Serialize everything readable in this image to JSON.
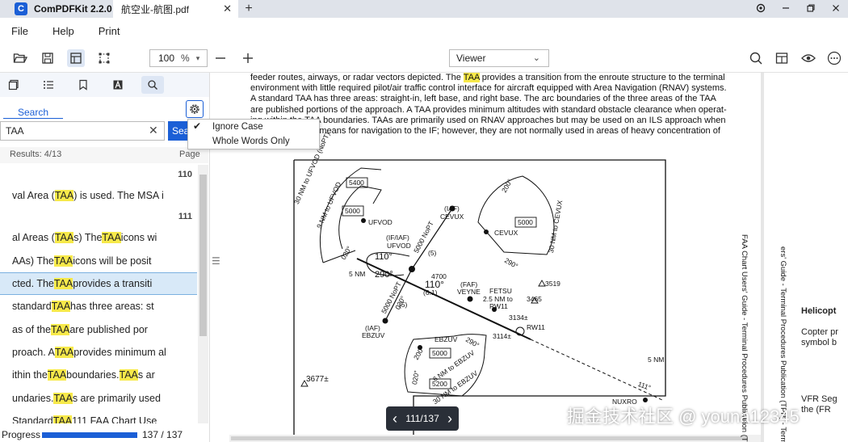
{
  "titlebar": {
    "app_name": "ComPDFKit 2.2.0",
    "app_logo": "C",
    "doc_tab": "航空业-航图.pdf",
    "close_glyph": "✕",
    "new_tab_glyph": "+"
  },
  "menu": [
    "File",
    "Help",
    "Print"
  ],
  "toolbar": {
    "zoom_value": "100",
    "zoom_unit": "%",
    "view_mode": "Viewer"
  },
  "sidebar": {
    "search_tab_label": "Search",
    "search_value": "TAA",
    "search_button": "Search",
    "results_label": "Results: 4/13",
    "page_label": "Page",
    "options": [
      "Ignore Case",
      "Whole Words Only"
    ],
    "checked_option": "Ignore Case",
    "progress_label": "Progress",
    "progress_value": "137 / 137",
    "progress_fraction": 1.0,
    "results": [
      {
        "type": "page",
        "text": "110"
      },
      {
        "type": "hit",
        "pre": "val Area (",
        "hit": "TAA",
        "post": ") is used. The MSA i"
      },
      {
        "type": "page",
        "text": "111"
      },
      {
        "type": "hit",
        "pre": "al Areas (",
        "hit": "TAA",
        "post": "s)  The ",
        "hit2": "TAA",
        "post2": " icons wi"
      },
      {
        "type": "hit",
        "pre": "AAs)  The ",
        "hit": "TAA",
        "post": " icons will be posit"
      },
      {
        "type": "hit",
        "pre": "cted. The ",
        "hit": "TAA",
        "post": " provides a transiti",
        "selected": true
      },
      {
        "type": "hit",
        "pre": "standard ",
        "hit": "TAA",
        "post": " has three areas: st"
      },
      {
        "type": "hit",
        "pre": "as of the ",
        "hit": "TAA",
        "post": "  are published por"
      },
      {
        "type": "hit",
        "pre": "proach. A ",
        "hit": "TAA",
        "post": " provides minimum al"
      },
      {
        "type": "hit",
        "pre": "ithin the ",
        "hit": "TAA",
        "post": " boundaries. ",
        "hit2": "TAA",
        "post2": "s ar"
      },
      {
        "type": "hit",
        "pre": "undaries. ",
        "hit": "TAA",
        "post": "s are primarily used"
      },
      {
        "type": "hit",
        "pre": "Standard ",
        "hit": "TAA",
        "post": "  111  FAA Chart Use"
      }
    ]
  },
  "document": {
    "lines": [
      {
        "pre": "feeder routes, airways, or radar vectors depicted. The ",
        "hit": "TAA",
        "post": " provides a transition from the enroute structure to the terminal"
      },
      {
        "pre": "environment with little required pilot/air traffic control interface for aircraft equipped with Area Navigation (RNAV) systems."
      },
      {
        "pre": "A standard TAA has three areas: straight-in, left base, and right base. The arc boundaries of the three areas of the TAA"
      },
      {
        "pre": "are published portions of the approach. A TAA provides minimum altitudes with standard obstacle clearance when operat-"
      },
      {
        "pre": "ing within the TAA boundaries. TAAs are primarily used on RNAV approaches but may be used on an ILS approach when"
      },
      {
        "pre": "RNAV is the sole means for navigation to the IF; however, they are not normally used in areas of heavy concentration of"
      }
    ],
    "chart_labels": {
      "ufvod_route_1": "30 NM to UFVOD (NoPT)",
      "ufvod_route_2": "9 NM to UFVOD",
      "alt_5400": "5400",
      "alt_5000_a": "5000",
      "ufvod": "UFVOD",
      "cevux_iaf": "(IAF)",
      "cevux": "CEVUX",
      "if_iaf": "(IF/IAF)",
      "ufvod_2": "UFVOD",
      "nopt_5000": "5000 NoPT",
      "nopt_5000_val": "(5)",
      "cevux_route": "30 NM to CEVUX",
      "alt_5000_b": "5000",
      "cevux_2": "CEVUX",
      "deg_200_a": "200°",
      "deg_290_a": "290°",
      "deg_020_a": "020°",
      "deg_110_a": "110°",
      "five_nm_a": "5 NM",
      "deg_290_b": "290°",
      "alt_4700": "4700",
      "deg_110_b": "110°",
      "dist_61": "(6.1)",
      "faf": "(FAF)",
      "veyne": "VEYNE",
      "fetsu": "FETSU",
      "rw11_dist": "2.5 NM to",
      "rw11_a": "RW11",
      "elev_3519": "3519",
      "elev_3465": "3465",
      "elev_3134": "3134±",
      "rw11_b": "RW11",
      "elev_3114": "3114±",
      "nopt_5000_b": "5000 NoPT",
      "deg_020_b": "020°",
      "dist_5": "(5)",
      "ebzuv_iaf": "(IAF)",
      "ebzuv": "EBZUV",
      "ebzuv_2": "EBZUV",
      "alt_5000_c": "5000",
      "ebzuv_route_1": "6 NM to EBZUV",
      "alt_5200": "5200",
      "ebzuv_route_2": "30 NM to EBZUV",
      "deg_200_b": "200°",
      "deg_290_c": "290°",
      "deg_020_c": "020°",
      "elev_3677": "3677±",
      "five_nm_b": "5 NM",
      "deg_111": "111°",
      "nuxro": "NUXRO"
    },
    "vertical_text_1": "FAA Chart Users' Guide - Terminal Procedures Publication (TPP",
    "vertical_text_2": "ers' Guide - Terminal Procedures Publication (TPP) - Terms",
    "right_heading": "Helicopt",
    "right_text_1": "Copter pr",
    "right_text_2": "symbol b",
    "right_text_3": "VFR Seg",
    "right_text_4": "the (FR"
  },
  "page_nav": {
    "prev": "‹",
    "label": "111/137",
    "next": "›"
  },
  "watermark": "掘金技术社区 @ youna12345"
}
